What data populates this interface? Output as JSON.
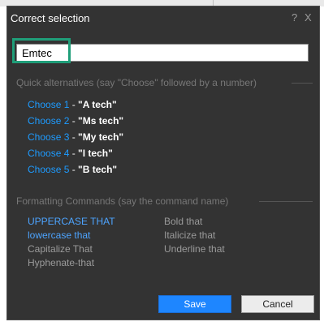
{
  "dialog": {
    "title": "Correct selection",
    "help_glyph": "?",
    "close_glyph": "X"
  },
  "input": {
    "value": "Emtec"
  },
  "alternatives": {
    "heading": "Quick alternatives (say \"Choose\" followed by a number)",
    "separator": " - ",
    "items": [
      {
        "choose": "Choose 1",
        "text": "\"A tech\""
      },
      {
        "choose": "Choose 2",
        "text": "\"Ms tech\""
      },
      {
        "choose": "Choose 3",
        "text": "\"My tech\""
      },
      {
        "choose": "Choose 4",
        "text": "\"I tech\""
      },
      {
        "choose": "Choose 5",
        "text": "\"B tech\""
      }
    ]
  },
  "formatting": {
    "heading": "Formatting Commands (say the command name)",
    "col1": [
      "UPPERCASE THAT",
      "lowercase that",
      "Capitalize That",
      "Hyphenate-that"
    ],
    "col2": [
      "Bold that",
      "Italicize that",
      "Underline that"
    ]
  },
  "buttons": {
    "save": "Save",
    "cancel": "Cancel"
  },
  "colors": {
    "accent_blue": "#1e86ff",
    "link_blue": "#1e9bff",
    "highlight_green": "#1f9e79",
    "dialog_bg": "#333333"
  }
}
